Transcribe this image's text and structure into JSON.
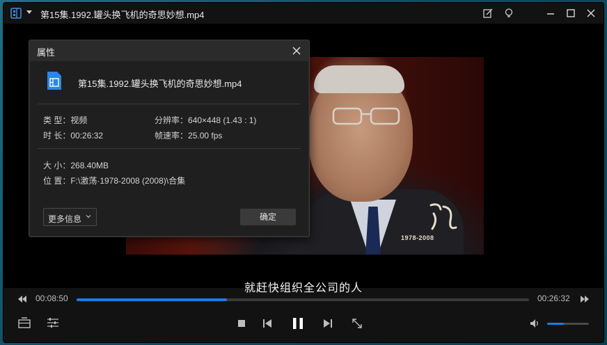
{
  "window": {
    "title": "第15集.1992.罐头换飞机的奇思妙想.mp4"
  },
  "video": {
    "subtitle": "就赶快组织全公司的人",
    "watermark": "1978-2008"
  },
  "dialog": {
    "title": "属性",
    "file_name": "第15集.1992.罐头换飞机的奇思妙想.mp4",
    "type_label": "类 型：",
    "type_value": "视频",
    "resolution_label": "分辨率：",
    "resolution_value": "640×448 (1.43 : 1)",
    "duration_label": "时 长：",
    "duration_value": "00:26:32",
    "framerate_label": "帧速率：",
    "framerate_value": "25.00 fps",
    "size_label": "大 小：",
    "size_value": "268.40MB",
    "location_label": "位 置：",
    "location_value": "F:\\激荡·1978-2008 (2008)\\合集",
    "more_info_label": "更多信息",
    "ok_label": "确定"
  },
  "playback": {
    "current_time": "00:08:50",
    "total_time": "00:26:32",
    "progress": 0.333,
    "volume": 0.4,
    "state": "playing"
  },
  "colors": {
    "accent": "#1a7fe0",
    "background": "#121212",
    "dialog_bg": "#1f1f1f"
  },
  "icons": {
    "app": "film-app-icon",
    "titlebar": [
      "edit-icon",
      "bulb-icon",
      "minimize-icon",
      "maximize-icon",
      "close-icon"
    ],
    "controls": [
      "rewind-icon",
      "forward-icon",
      "playlist-icon",
      "settings-sliders-icon",
      "stop-icon",
      "previous-icon",
      "pause-icon",
      "next-icon",
      "fullscreen-icon",
      "volume-icon"
    ]
  }
}
